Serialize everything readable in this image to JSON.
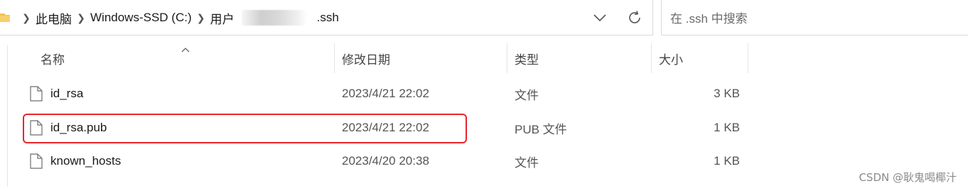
{
  "address_bar": {
    "breadcrumbs": [
      "此电脑",
      "Windows-SSD (C:)",
      "用户",
      ".ssh"
    ],
    "separator": ">"
  },
  "search": {
    "placeholder": "在 .ssh 中搜索"
  },
  "columns": {
    "name": "名称",
    "date": "修改日期",
    "type": "类型",
    "size": "大小"
  },
  "files": [
    {
      "name": "id_rsa",
      "modified": "2023/4/21 22:02",
      "type": "文件",
      "size": "3 KB",
      "icon": "file-icon"
    },
    {
      "name": "id_rsa.pub",
      "modified": "2023/4/21 22:02",
      "type": "PUB 文件",
      "size": "1 KB",
      "icon": "file-icon"
    },
    {
      "name": "known_hosts",
      "modified": "2023/4/20 20:38",
      "type": "文件",
      "size": "1 KB",
      "icon": "file-icon"
    }
  ],
  "highlighted_file": "id_rsa.pub",
  "highlight_color": "#e8262a",
  "watermark": "CSDN @耿鬼喝椰汁"
}
